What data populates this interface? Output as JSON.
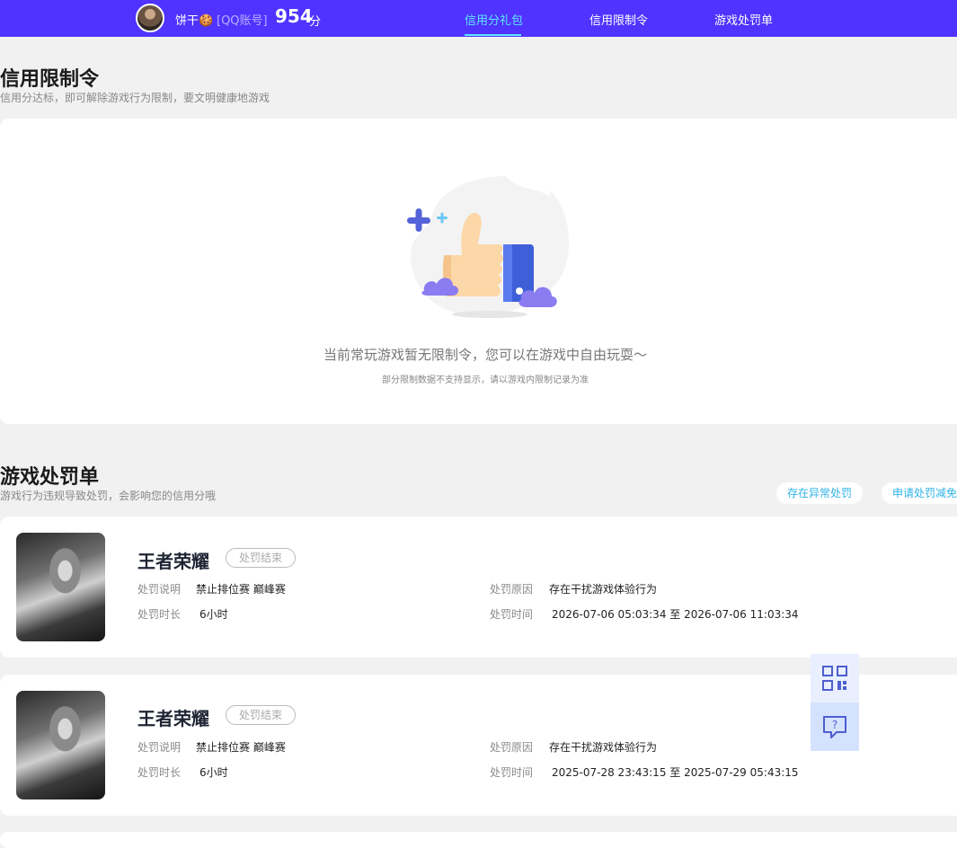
{
  "header": {
    "username": "饼干🍪",
    "account_type": "[QQ账号]",
    "score": "954",
    "score_unit": "分",
    "tabs": [
      {
        "label": "信用分礼包",
        "active": true
      },
      {
        "label": "信用限制令",
        "active": false
      },
      {
        "label": "游戏处罚单",
        "active": false
      }
    ]
  },
  "restriction": {
    "title": "信用限制令",
    "subtitle": "信用分达标，即可解除游戏行为限制，要文明健康地游戏",
    "empty_title": "当前常玩游戏暂无限制令，您可以在游戏中自由玩耍～",
    "empty_note": "部分限制数据不支持显示，请以游戏内限制记录为准"
  },
  "penalty": {
    "title": "游戏处罚单",
    "subtitle": "游戏行为违规导致处罚，会影响您的信用分哦",
    "buttons": {
      "abnormal": "存在异常处罚",
      "appeal": "申请处罚减免"
    },
    "labels": {
      "desc": "处罚说明",
      "duration": "处罚时长",
      "reason": "处罚原因",
      "time": "处罚时间"
    },
    "records": [
      {
        "game": "王者荣耀",
        "status": "处罚结束",
        "desc": "禁止排位赛 巅峰赛",
        "duration": "6小时",
        "reason": "存在干扰游戏体验行为",
        "time": "2026-07-06 05:03:34 至 2026-07-06 11:03:34"
      },
      {
        "game": "王者荣耀",
        "status": "处罚结束",
        "desc": "禁止排位赛 巅峰赛",
        "duration": "6小时",
        "reason": "存在干扰游戏体验行为",
        "time": "2025-07-28 23:43:15 至 2025-07-29 05:43:15"
      }
    ]
  },
  "colors": {
    "brand": "#5033ff",
    "accent": "#5fe8ff",
    "link": "#2fb3e6"
  },
  "icons": {
    "float_top": "qr-code-icon",
    "float_bottom": "help-chat-icon"
  }
}
